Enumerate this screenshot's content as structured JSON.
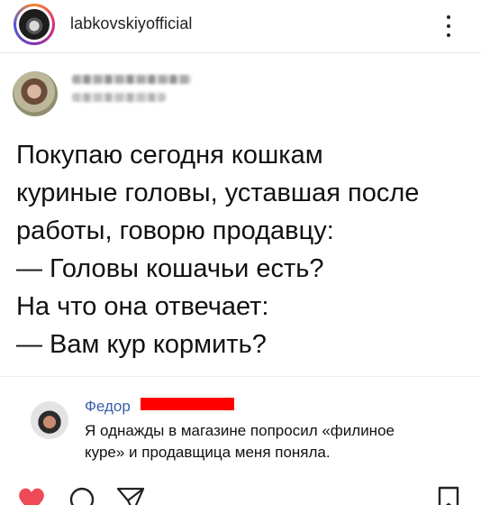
{
  "header": {
    "username": "labkovskiyofficial"
  },
  "post": {
    "lines": [
      "Покупаю сегодня кошкам",
      "куриные головы, уставшая после",
      "работы, говорю продавцу:",
      "— Головы кошачьи есть?",
      "На что она отвечает:",
      "— Вам кур кормить?"
    ]
  },
  "comment": {
    "author": "Федор",
    "lines": [
      "Я однажды в магазине попросил «филиное",
      "куре» и продавщица меня поняла."
    ]
  },
  "actions": {
    "like_icon": "heart-icon",
    "comment_icon": "comment-icon",
    "share_icon": "send-icon",
    "save_icon": "bookmark-icon",
    "like_color": "#ed4956"
  }
}
